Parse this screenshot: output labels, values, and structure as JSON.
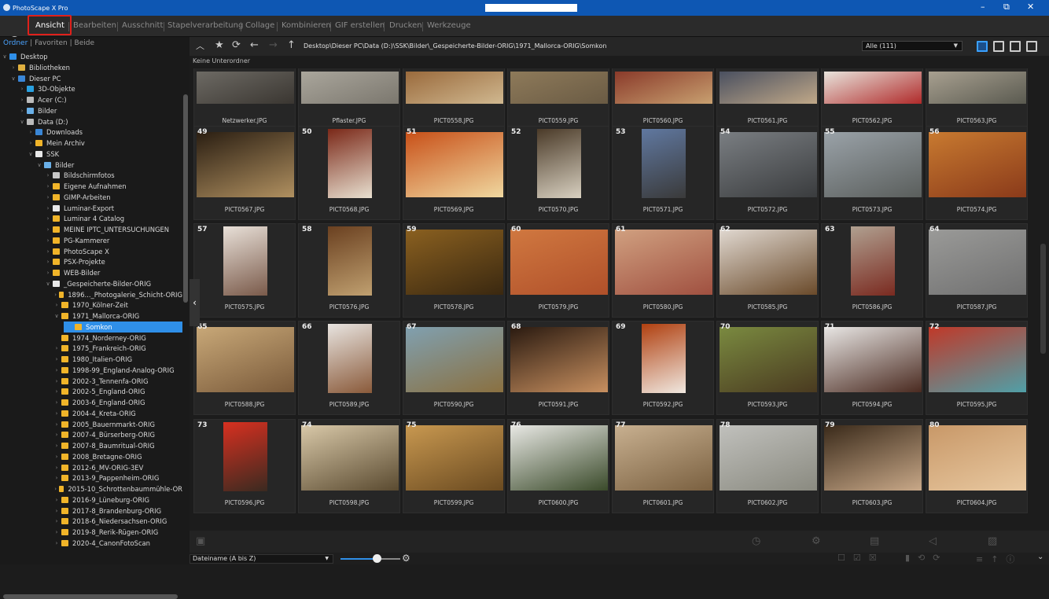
{
  "window": {
    "title": "PhotoScape X Pro",
    "controls": [
      "–",
      "⧉",
      "✕"
    ]
  },
  "menu": [
    {
      "label": "Ansicht",
      "active": true
    },
    {
      "label": "Bearbeiten"
    },
    {
      "label": "Ausschnitt"
    },
    {
      "label": "Stapelverarbeitung"
    },
    {
      "label": "Collage"
    },
    {
      "label": "Kombinieren"
    },
    {
      "label": "GIF erstellen"
    },
    {
      "label": "Drucken"
    },
    {
      "label": "Werkzeuge"
    }
  ],
  "sidebar": {
    "tabs": [
      "Ordner",
      "Favoriten",
      "Beide"
    ],
    "tree": [
      {
        "label": "Desktop",
        "depth": 0,
        "arrow": "v",
        "icon": "desktop"
      },
      {
        "label": "Bibliotheken",
        "depth": 1,
        "arrow": ">",
        "icon": "library"
      },
      {
        "label": "Dieser PC",
        "depth": 1,
        "arrow": "v",
        "icon": "pc"
      },
      {
        "label": "3D-Objekte",
        "depth": 2,
        "arrow": ">",
        "icon": "3d"
      },
      {
        "label": "Acer (C:)",
        "depth": 2,
        "arrow": ">",
        "icon": "drive"
      },
      {
        "label": "Bilder",
        "depth": 2,
        "arrow": ">",
        "icon": "pictures"
      },
      {
        "label": "Data (D:)",
        "depth": 2,
        "arrow": "v",
        "icon": "drive"
      },
      {
        "label": "Downloads",
        "depth": 3,
        "arrow": ">",
        "icon": "download"
      },
      {
        "label": "Mein Archiv",
        "depth": 3,
        "arrow": ">",
        "icon": "folder"
      },
      {
        "label": "SSK",
        "depth": 3,
        "arrow": "v",
        "icon": "ssk"
      },
      {
        "label": "Bilder",
        "depth": 4,
        "arrow": "v",
        "icon": "pictures"
      },
      {
        "label": "Bildschirmfotos",
        "depth": 5,
        "arrow": ">",
        "icon": "screenshot"
      },
      {
        "label": "Eigene Aufnahmen",
        "depth": 5,
        "arrow": ">",
        "icon": "folder"
      },
      {
        "label": "GIMP-Arbeiten",
        "depth": 5,
        "arrow": ">",
        "icon": "folder"
      },
      {
        "label": "Luminar-Export",
        "depth": 5,
        "arrow": ">",
        "icon": "luminar"
      },
      {
        "label": "Luminar 4 Catalog",
        "depth": 5,
        "arrow": ">",
        "icon": "folder"
      },
      {
        "label": "MEINE IPTC_UNTERSUCHUNGEN",
        "depth": 5,
        "arrow": ">",
        "icon": "folder"
      },
      {
        "label": "PG-Kammerer",
        "depth": 5,
        "arrow": ">",
        "icon": "folder"
      },
      {
        "label": "PhotoScape X",
        "depth": 5,
        "arrow": ">",
        "icon": "folder"
      },
      {
        "label": "PSX-Projekte",
        "depth": 5,
        "arrow": ">",
        "icon": "folder"
      },
      {
        "label": "WEB-Bilder",
        "depth": 5,
        "arrow": ">",
        "icon": "folder"
      },
      {
        "label": "_Gespeicherte-Bilder-ORIG",
        "depth": 5,
        "arrow": "v",
        "icon": "orig"
      },
      {
        "label": "1896..._Photogalerie_Schicht-ORIG",
        "depth": 6,
        "arrow": ">",
        "icon": "folder"
      },
      {
        "label": "1970_Kölner-Zeit",
        "depth": 6,
        "arrow": ">",
        "icon": "folder"
      },
      {
        "label": "1971_Mallorca-ORIG",
        "depth": 6,
        "arrow": "v",
        "icon": "folder"
      },
      {
        "label": "Somkon",
        "depth": 7,
        "arrow": "",
        "icon": "folder",
        "selected": true
      },
      {
        "label": "1974_Norderney-ORIG",
        "depth": 6,
        "arrow": "",
        "icon": "folder"
      },
      {
        "label": "1975_Frankreich-ORIG",
        "depth": 6,
        "arrow": ">",
        "icon": "folder"
      },
      {
        "label": "1980_Italien-ORIG",
        "depth": 6,
        "arrow": ">",
        "icon": "folder"
      },
      {
        "label": "1998-99_England-Analog-ORIG",
        "depth": 6,
        "arrow": ">",
        "icon": "folder"
      },
      {
        "label": "2002-3_Tennenfa-ORIG",
        "depth": 6,
        "arrow": ">",
        "icon": "folder"
      },
      {
        "label": "2002-5_England-ORIG",
        "depth": 6,
        "arrow": ">",
        "icon": "folder"
      },
      {
        "label": "2003-6_England-ORIG",
        "depth": 6,
        "arrow": ">",
        "icon": "folder"
      },
      {
        "label": "2004-4_Kreta-ORIG",
        "depth": 6,
        "arrow": ">",
        "icon": "folder"
      },
      {
        "label": "2005_Bauernmarkt-ORIG",
        "depth": 6,
        "arrow": ">",
        "icon": "folder"
      },
      {
        "label": "2007-4_Bürserberg-ORIG",
        "depth": 6,
        "arrow": ">",
        "icon": "folder"
      },
      {
        "label": "2007-8_Baumritual-ORIG",
        "depth": 6,
        "arrow": ">",
        "icon": "folder"
      },
      {
        "label": "2008_Bretagne-ORIG",
        "depth": 6,
        "arrow": ">",
        "icon": "folder"
      },
      {
        "label": "2012-6_MV-ORIG-3EV",
        "depth": 6,
        "arrow": ">",
        "icon": "folder"
      },
      {
        "label": "2013-9_Pappenheim-ORIG",
        "depth": 6,
        "arrow": ">",
        "icon": "folder"
      },
      {
        "label": "2015-10_Schrottenbaummühle-OR",
        "depth": 6,
        "arrow": ">",
        "icon": "folder"
      },
      {
        "label": "2016-9_Lüneburg-ORIG",
        "depth": 6,
        "arrow": ">",
        "icon": "folder"
      },
      {
        "label": "2017-8_Brandenburg-ORIG",
        "depth": 6,
        "arrow": ">",
        "icon": "folder"
      },
      {
        "label": "2018-6_Niedersachsen-ORIG",
        "depth": 6,
        "arrow": ">",
        "icon": "folder"
      },
      {
        "label": "2019-8_Rerik-Rügen-ORIG",
        "depth": 6,
        "arrow": ">",
        "icon": "folder"
      },
      {
        "label": "2020-4_CanonFotoScan",
        "depth": 6,
        "arrow": ">",
        "icon": "folder"
      }
    ]
  },
  "toolbar": {
    "path": "Desktop\\Dieser PC\\Data (D:)\\SSK\\Bilder\\_Gespeicherte-Bilder-ORIG\\1971_Mallorca-ORIG\\Somkon",
    "filter": "Alle (111)"
  },
  "subheader": "Keine Unterordner",
  "rows": [
    [
      {
        "n": "",
        "f": "Netzwerker.JPG",
        "c": [
          "#6d6a64",
          "#3a3631"
        ]
      },
      {
        "n": "",
        "f": "Pflaster.JPG",
        "c": [
          "#aaa69c",
          "#7b776e"
        ]
      },
      {
        "n": "",
        "f": "PICT0558.JPG",
        "c": [
          "#9a6a3c",
          "#d0b890"
        ]
      },
      {
        "n": "",
        "f": "PICT0559.JPG",
        "c": [
          "#8e7a5a",
          "#6a5b44"
        ]
      },
      {
        "n": "",
        "f": "PICT0560.JPG",
        "c": [
          "#8a3a2a",
          "#c8a070"
        ]
      },
      {
        "n": "",
        "f": "PICT0561.JPG",
        "c": [
          "#4a5060",
          "#c0a888"
        ]
      },
      {
        "n": "",
        "f": "PICT0562.JPG",
        "c": [
          "#e8e4dc",
          "#b02a2a"
        ]
      },
      {
        "n": "",
        "f": "PICT0563.JPG",
        "c": [
          "#a8a090",
          "#5a5a50"
        ]
      }
    ],
    [
      {
        "n": "49",
        "f": "PICT0567.JPG",
        "c": [
          "#2a1e12",
          "#b09060"
        ]
      },
      {
        "n": "50",
        "f": "PICT0568.JPG",
        "c": [
          "#7a2818",
          "#e8e0d0"
        ]
      },
      {
        "n": "51",
        "f": "PICT0569.JPG",
        "c": [
          "#c85018",
          "#f0d8a0"
        ]
      },
      {
        "n": "52",
        "f": "PICT0570.JPG",
        "c": [
          "#4a3a28",
          "#d8d0c0"
        ]
      },
      {
        "n": "53",
        "f": "PICT0571.JPG",
        "c": [
          "#6078a0",
          "#3a3a3a"
        ]
      },
      {
        "n": "54",
        "f": "PICT0572.JPG",
        "c": [
          "#7a7e82",
          "#3a3c3e"
        ]
      },
      {
        "n": "55",
        "f": "PICT0573.JPG",
        "c": [
          "#9aa2a8",
          "#5a5e5c"
        ]
      },
      {
        "n": "56",
        "f": "PICT0574.JPG",
        "c": [
          "#c87a30",
          "#8a3a1a"
        ]
      }
    ],
    [
      {
        "n": "57",
        "f": "PICT0575.JPG",
        "c": [
          "#e8e0d8",
          "#7a5a4a"
        ]
      },
      {
        "n": "58",
        "f": "PICT0576.JPG",
        "c": [
          "#6a4020",
          "#c0a070"
        ]
      },
      {
        "n": "59",
        "f": "PICT0578.JPG",
        "c": [
          "#8a6020",
          "#3a2810"
        ]
      },
      {
        "n": "60",
        "f": "PICT0579.JPG",
        "c": [
          "#d07840",
          "#b0502a"
        ]
      },
      {
        "n": "61",
        "f": "PICT0580.JPG",
        "c": [
          "#d0a080",
          "#a05040"
        ]
      },
      {
        "n": "62",
        "f": "PICT0585.JPG",
        "c": [
          "#e0d8d0",
          "#6a4a2a"
        ]
      },
      {
        "n": "63",
        "f": "PICT0586.JPG",
        "c": [
          "#b0a090",
          "#7a2a20"
        ]
      },
      {
        "n": "64",
        "f": "PICT0587.JPG",
        "c": [
          "#9a9a98",
          "#707070"
        ]
      }
    ],
    [
      {
        "n": "65",
        "f": "PICT0588.JPG",
        "c": [
          "#c8a878",
          "#7a5a3a"
        ]
      },
      {
        "n": "66",
        "f": "PICT0589.JPG",
        "c": [
          "#e8e4e0",
          "#8a5a3a"
        ]
      },
      {
        "n": "67",
        "f": "PICT0590.JPG",
        "c": [
          "#80a0b0",
          "#8a7040"
        ]
      },
      {
        "n": "68",
        "f": "PICT0591.JPG",
        "c": [
          "#2a1a10",
          "#c89060"
        ]
      },
      {
        "n": "69",
        "f": "PICT0592.JPG",
        "c": [
          "#b04010",
          "#f0e8e0"
        ]
      },
      {
        "n": "70",
        "f": "PICT0593.JPG",
        "c": [
          "#7a8a40",
          "#4a3a20"
        ]
      },
      {
        "n": "71",
        "f": "PICT0594.JPG",
        "c": [
          "#e8e6e4",
          "#4a2a20"
        ]
      },
      {
        "n": "72",
        "f": "PICT0595.JPG",
        "c": [
          "#c03828",
          "#50a0a8"
        ]
      }
    ],
    [
      {
        "n": "73",
        "f": "PICT0596.JPG",
        "c": [
          "#d83020",
          "#3a2a20"
        ]
      },
      {
        "n": "74",
        "f": "PICT0598.JPG",
        "c": [
          "#d8c8a8",
          "#5a4a30"
        ]
      },
      {
        "n": "75",
        "f": "PICT0599.JPG",
        "c": [
          "#c89850",
          "#6a4a20"
        ]
      },
      {
        "n": "76",
        "f": "PICT0600.JPG",
        "c": [
          "#e8e8e4",
          "#3a4a2a"
        ]
      },
      {
        "n": "77",
        "f": "PICT0601.JPG",
        "c": [
          "#c8b090",
          "#7a6040"
        ]
      },
      {
        "n": "78",
        "f": "PICT0602.JPG",
        "c": [
          "#c0c0bc",
          "#8a8a80"
        ]
      },
      {
        "n": "79",
        "f": "PICT0603.JPG",
        "c": [
          "#3a2a1a",
          "#c8a888"
        ]
      },
      {
        "n": "80",
        "f": "PICT0604.JPG",
        "c": [
          "#c89868",
          "#e8c8a0"
        ]
      }
    ]
  ],
  "statusbar": {
    "sort": "Dateiname (A bis Z)"
  },
  "colors": {
    "accent": "#2f8fe8",
    "highlight": "#e0201b",
    "titlebar": "#0e57b3"
  }
}
